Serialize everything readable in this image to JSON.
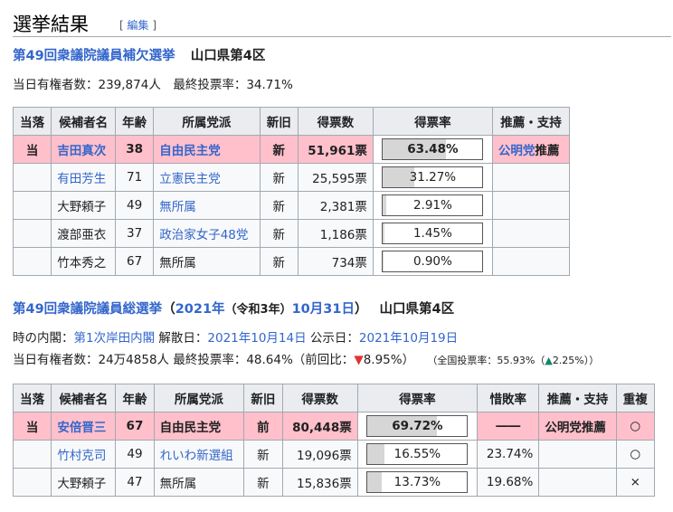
{
  "heading": {
    "title": "選挙結果",
    "edit_open": "[",
    "edit_label": "編集",
    "edit_close": "]"
  },
  "by_election": {
    "title": "第49回衆議院議員補欠選挙",
    "district": "山口県第4区",
    "summary": "当日有権者数：239,874人　最終投票率：34.71%",
    "headers": [
      "当落",
      "候補者名",
      "年齢",
      "所属党派",
      "新旧",
      "得票数",
      "得票率",
      "推薦・支持"
    ],
    "rows": [
      {
        "result": "当",
        "name": "吉田真次",
        "age": "38",
        "party": "自由民主党",
        "status": "新",
        "votes": "51,961票",
        "pct_label": "63.48%",
        "pct": 63.48,
        "support_link": "公明党",
        "support_suffix": "推薦",
        "win": true,
        "name_link": true,
        "party_link": true
      },
      {
        "result": "",
        "name": "有田芳生",
        "age": "71",
        "party": "立憲民主党",
        "status": "新",
        "votes": "25,595票",
        "pct_label": "31.27%",
        "pct": 31.27,
        "support_link": "",
        "support_suffix": "",
        "win": false,
        "name_link": true,
        "party_link": true
      },
      {
        "result": "",
        "name": "大野頼子",
        "age": "49",
        "party": "無所属",
        "status": "新",
        "votes": "2,381票",
        "pct_label": "2.91%",
        "pct": 2.91,
        "support_link": "",
        "support_suffix": "",
        "win": false,
        "name_link": false,
        "party_link": true
      },
      {
        "result": "",
        "name": "渡部亜衣",
        "age": "37",
        "party": "政治家女子48党",
        "status": "新",
        "votes": "1,186票",
        "pct_label": "1.45%",
        "pct": 1.45,
        "support_link": "",
        "support_suffix": "",
        "win": false,
        "name_link": false,
        "party_link": true
      },
      {
        "result": "",
        "name": "竹本秀之",
        "age": "67",
        "party": "無所属",
        "status": "新",
        "votes": "734票",
        "pct_label": "0.90%",
        "pct": 0.9,
        "support_link": "",
        "support_suffix": "",
        "win": false,
        "name_link": false,
        "party_link": false
      }
    ]
  },
  "general": {
    "title_1": "第49回衆議院議員総選挙",
    "paren_open": "（",
    "year": "2021年",
    "era": "（令和3年）",
    "date": "10月31日",
    "paren_close": "）",
    "district": "山口県第4区",
    "cabinet_prefix": "時の内閣：",
    "cabinet": "第1次岸田内閣",
    "dissolution_prefix": " 解散日：",
    "dissolution": "2021年10月14日",
    "announce_prefix": " 公示日：",
    "announce": "2021年10月19日",
    "summary_main": "当日有権者数：24万4858人 最終投票率：48.64%（前回比：",
    "down_arrow": "▼",
    "change": "8.95%）",
    "national_prefix": "（全国投票率：55.93%（",
    "up_arrow": "▲",
    "national_change": "2.25%））",
    "headers": [
      "当落",
      "候補者名",
      "年齢",
      "所属党派",
      "新旧",
      "得票数",
      "得票率",
      "惜敗率",
      "推薦・支持",
      "重複"
    ],
    "rows": [
      {
        "result": "当",
        "name": "安倍晋三",
        "age": "67",
        "party": "自由民主党",
        "status": "前",
        "votes": "80,448票",
        "pct_label": "69.72%",
        "pct": 69.72,
        "sekihai": "――",
        "support": "公明党推薦",
        "dup": "○",
        "win": true,
        "name_link": true,
        "party_link": false
      },
      {
        "result": "",
        "name": "竹村克司",
        "age": "49",
        "party": "れいわ新選組",
        "status": "新",
        "votes": "19,096票",
        "pct_label": "16.55%",
        "pct": 16.55,
        "sekihai": "23.74%",
        "support": "",
        "dup": "○",
        "win": false,
        "name_link": true,
        "party_link": true
      },
      {
        "result": "",
        "name": "大野頼子",
        "age": "47",
        "party": "無所属",
        "status": "新",
        "votes": "15,836票",
        "pct_label": "13.73%",
        "pct": 13.73,
        "sekihai": "19.68%",
        "support": "",
        "dup": "×",
        "win": false,
        "name_link": false,
        "party_link": false
      }
    ]
  }
}
